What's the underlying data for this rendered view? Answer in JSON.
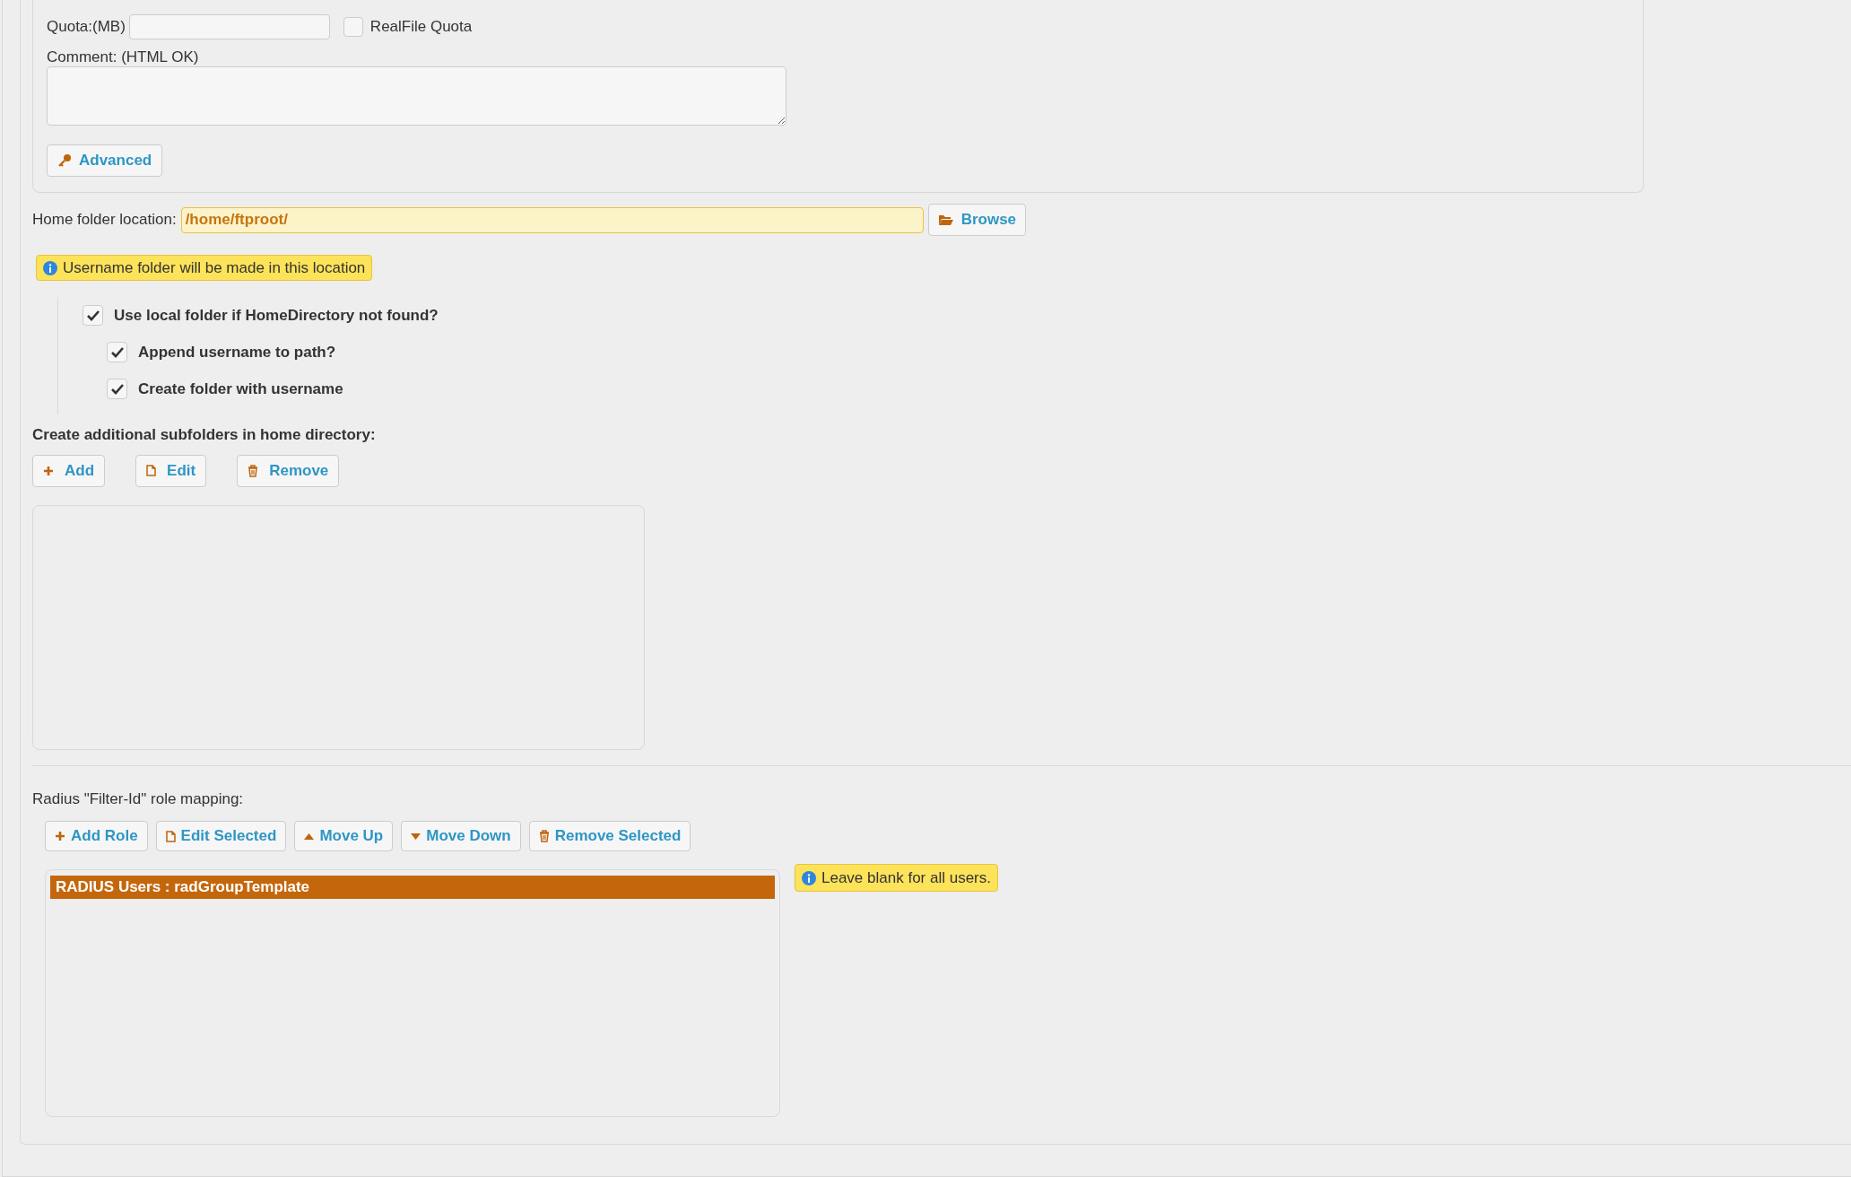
{
  "quota": {
    "label": "Quota:(MB)"
  },
  "realfile_quota": {
    "label": "RealFile Quota",
    "checked": false
  },
  "comment": {
    "label": "Comment: (HTML OK)"
  },
  "advanced_button": "Advanced",
  "home_folder": {
    "label": "Home folder location:",
    "value": "/home/ftproot/",
    "browse_button": "Browse"
  },
  "home_note": "Username folder will be made in this location",
  "options": [
    {
      "label": "Use local folder if HomeDirectory not found?",
      "checked": true,
      "children": [
        {
          "label": "Append username to path?",
          "checked": true
        },
        {
          "label": "Create folder with username",
          "checked": true
        }
      ]
    }
  ],
  "subfolders": {
    "heading": "Create additional subfolders in home directory:",
    "buttons": [
      {
        "kind": "add",
        "label": "Add"
      },
      {
        "kind": "edit",
        "label": "Edit"
      },
      {
        "kind": "remove",
        "label": "Remove"
      }
    ]
  },
  "role_mapping": {
    "label": "Radius \"Filter-Id\" role mapping:",
    "buttons": [
      {
        "kind": "add",
        "label": "Add Role"
      },
      {
        "kind": "edit",
        "label": "Edit Selected"
      },
      {
        "kind": "up",
        "label": "Move Up"
      },
      {
        "kind": "down",
        "label": "Move Down"
      },
      {
        "kind": "remove",
        "label": "Remove Selected"
      }
    ],
    "items": [
      {
        "label": "RADIUS Users : radGroupTemplate",
        "selected": true
      }
    ],
    "note": "Leave blank for all users."
  }
}
